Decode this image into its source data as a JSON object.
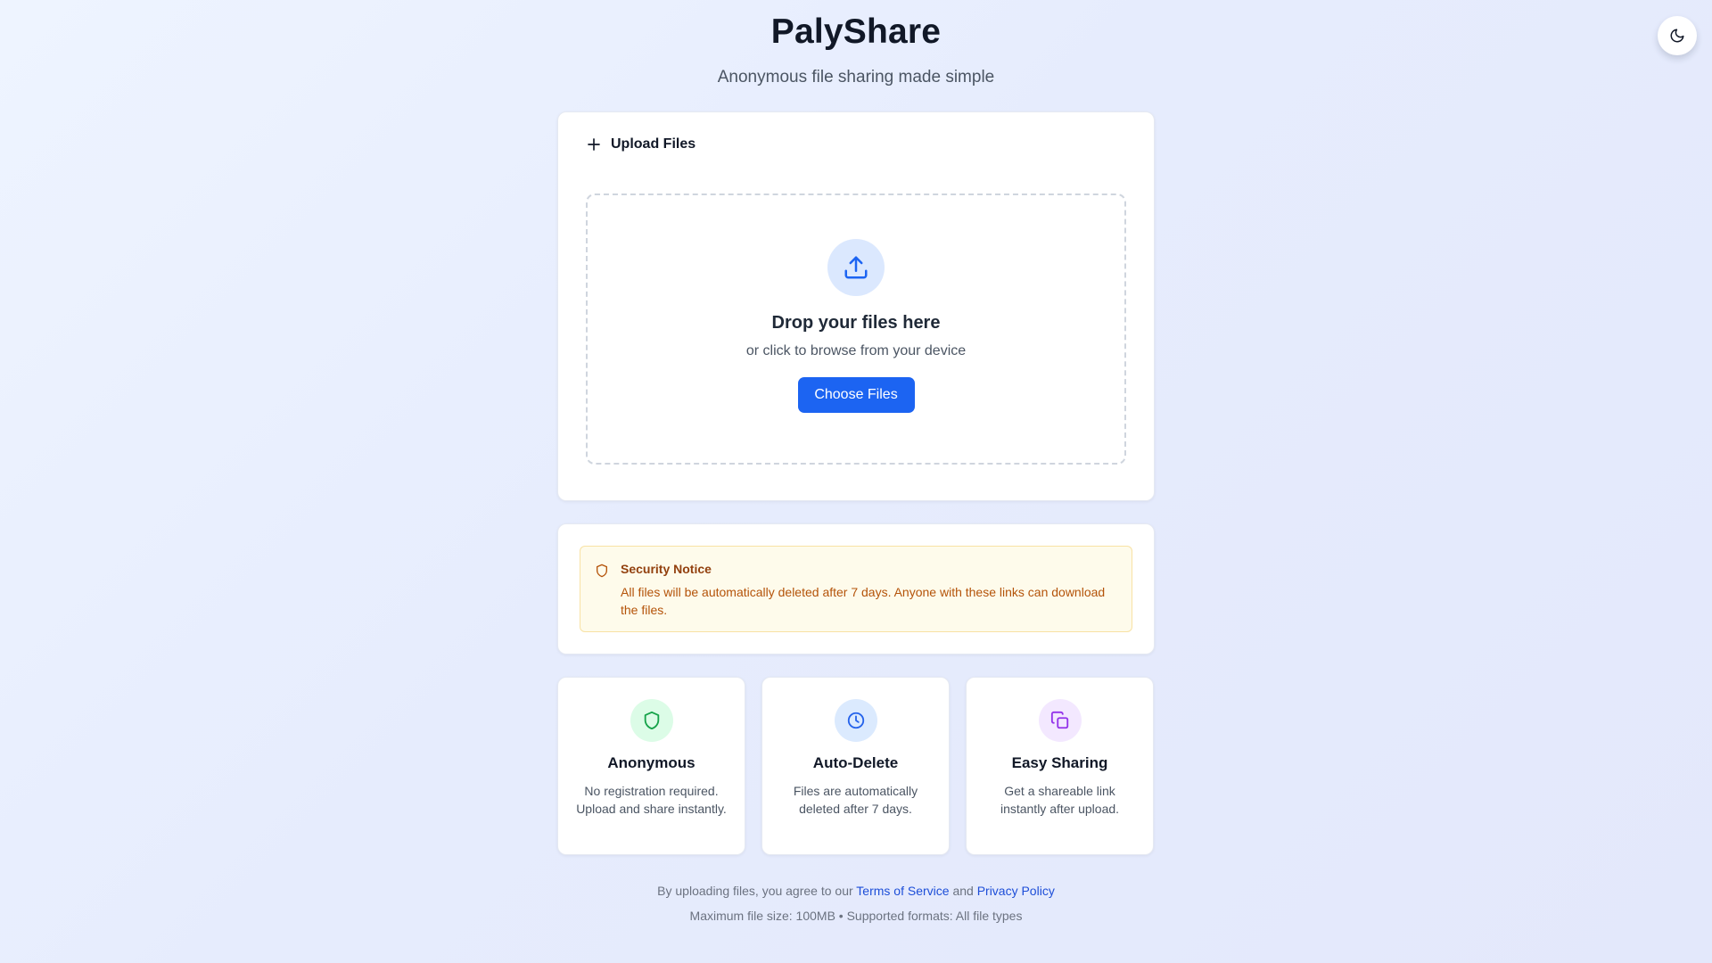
{
  "app": {
    "title": "PalyShare",
    "subtitle": "Anonymous file sharing made simple"
  },
  "theme_toggle": {
    "icon": "moon-icon"
  },
  "upload": {
    "header_label": "Upload Files",
    "header_icon": "plus-icon",
    "dropzone_icon": "upload-icon",
    "drop_title": "Drop your files here",
    "drop_subtitle": "or click to browse from your device",
    "button_label": "Choose Files"
  },
  "notice": {
    "icon": "shield-icon",
    "title": "Security Notice",
    "text": "All files will be automatically deleted after 7 days. Anyone with these links can download the files."
  },
  "features": [
    {
      "icon": "shield-icon",
      "title": "Anonymous",
      "description": "No registration required. Upload and share instantly.",
      "bg": "#dcfce7",
      "color": "#16a34a"
    },
    {
      "icon": "clock-icon",
      "title": "Auto-Delete",
      "description": "Files are automatically deleted after 7 days.",
      "bg": "#dbeafe",
      "color": "#2563eb"
    },
    {
      "icon": "copy-icon",
      "title": "Easy Sharing",
      "description": "Get a shareable link instantly after upload.",
      "bg": "#f3e8ff",
      "color": "#9333ea"
    }
  ],
  "footer": {
    "agree_prefix": "By uploading files, you agree to our",
    "terms_link": "Terms of Service",
    "and_text": "and",
    "privacy_link": "Privacy Policy",
    "limits": "Maximum file size: 100MB • Supported formats: All file types"
  },
  "colors": {
    "accent": "#1c64f2",
    "notice_bg": "#fefbeb",
    "notice_text": "#b45309",
    "link": "#1d4ed8"
  }
}
